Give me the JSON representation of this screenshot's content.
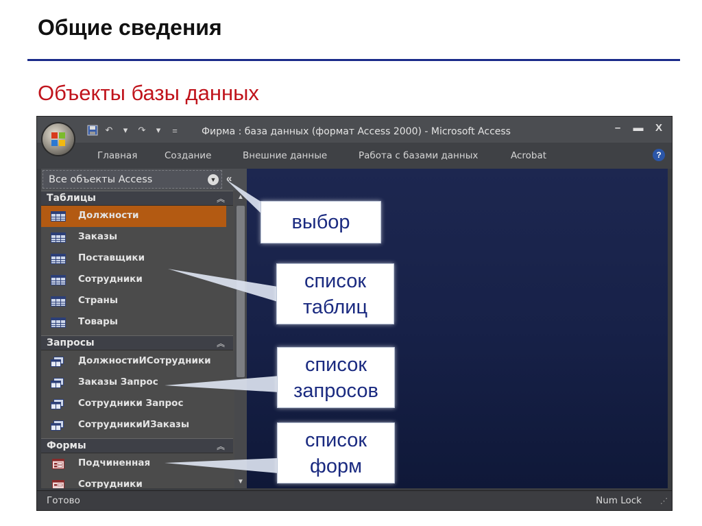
{
  "slide": {
    "title": "Общие сведения",
    "subtitle": "Объекты базы данных"
  },
  "window": {
    "title": "Фирма : база данных (формат Access 2000) - Microsoft Access",
    "qat_separator": "=",
    "controls": {
      "minimize": "–",
      "maximize": "▬",
      "close": "X"
    }
  },
  "ribbon": {
    "tabs": [
      "Главная",
      "Создание",
      "Внешние данные",
      "Работа с базами данных",
      "Acrobat"
    ],
    "help": "?"
  },
  "nav": {
    "dropdown_label": "Все объекты Access",
    "collapse_glyph": "«",
    "groups": [
      {
        "label": "Таблицы",
        "items": [
          "Должности",
          "Заказы",
          "Поставщики",
          "Сотрудники",
          "Страны",
          "Товары"
        ]
      },
      {
        "label": "Запросы",
        "items": [
          "ДолжностиИСотрудники",
          "Заказы Запрос",
          "Сотрудники Запрос",
          "СотрудникиИЗаказы"
        ]
      },
      {
        "label": "Формы",
        "items": [
          "Подчиненная",
          "Сотрудники"
        ]
      }
    ],
    "selected_item": "Должности"
  },
  "status": {
    "left": "Готово",
    "right": "Num Lock"
  },
  "callouts": {
    "choice": "выбор",
    "tables": [
      "список",
      "таблиц"
    ],
    "queries": [
      "список",
      "запросов"
    ],
    "forms": [
      "список",
      "форм"
    ]
  },
  "colors": {
    "title_rule": "#1a2a8a",
    "subtitle": "#c0141c",
    "selected": "#b35a12",
    "callout_text": "#1a2a80"
  }
}
